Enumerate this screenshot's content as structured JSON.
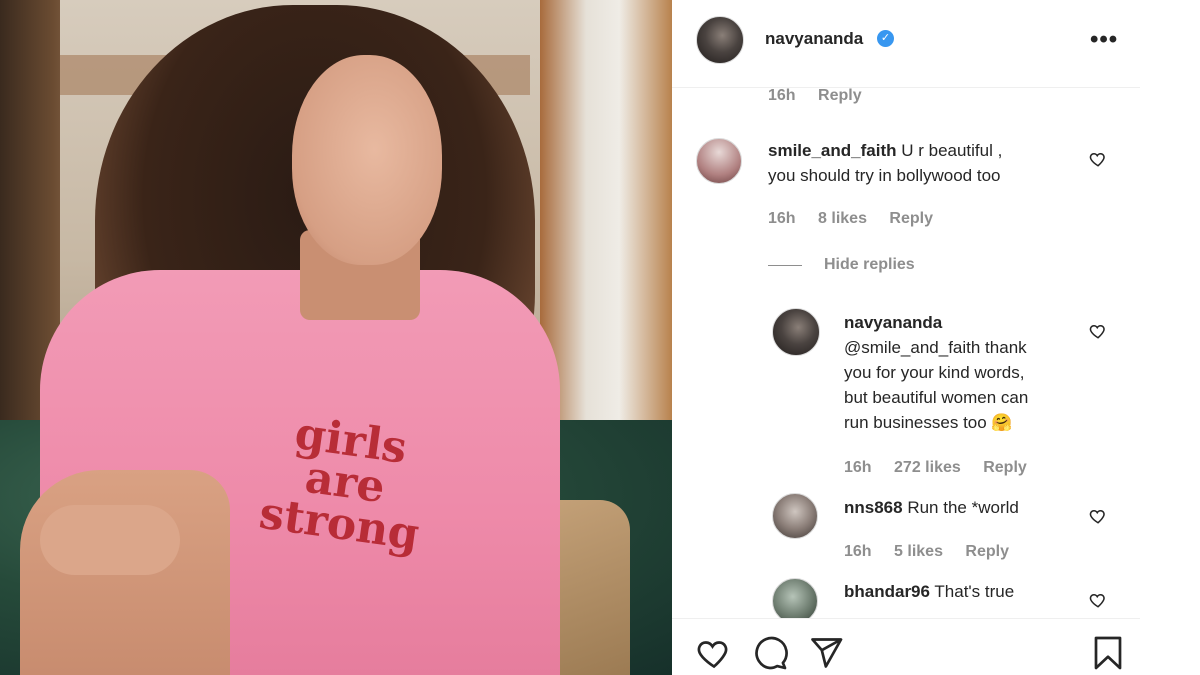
{
  "post": {
    "author": "navyananda",
    "image_print": [
      "girls",
      "are",
      "strong"
    ]
  },
  "comments": {
    "prev_meta": {
      "time": "16h",
      "reply": "Reply"
    },
    "items": [
      {
        "user": "smile_and_faith",
        "text_line1": "U r beautiful ,",
        "text_line2": "you should try in bollywood too",
        "time": "16h",
        "likes": "8 likes",
        "reply": "Reply"
      }
    ],
    "hide_replies": "Hide replies",
    "replies": [
      {
        "user": "navyananda",
        "lines": [
          "@smile_and_faith thank",
          "you for your kind words,",
          "but beautiful women can",
          "run businesses too 🤗"
        ],
        "time": "16h",
        "likes": "272 likes",
        "reply": "Reply"
      },
      {
        "user": "nns868",
        "text": "Run the *world",
        "time": "16h",
        "likes": "5 likes",
        "reply": "Reply"
      },
      {
        "user": "bhandar96",
        "text": "That's true"
      }
    ]
  },
  "icons": {
    "like": "heart-icon",
    "comment": "comment-icon",
    "share": "share-icon",
    "save": "bookmark-icon",
    "more": "more-options-icon",
    "verified": "verified-badge-icon"
  },
  "colors": {
    "verified": "#3897f0",
    "meta_text": "#8e8e8e",
    "primary_text": "#262626"
  }
}
